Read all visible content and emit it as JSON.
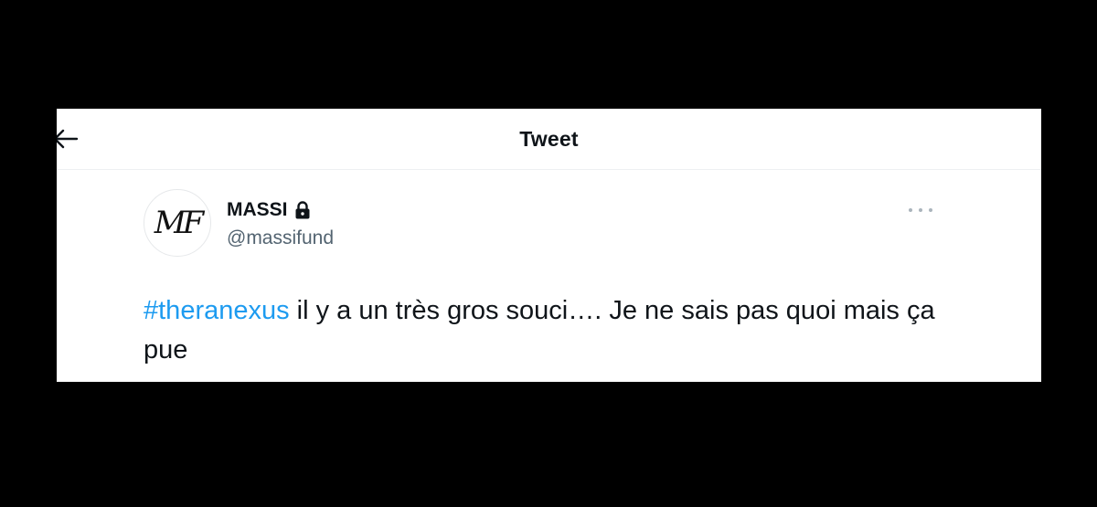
{
  "header": {
    "title": "Tweet",
    "back_icon": "arrow-left-icon"
  },
  "author": {
    "avatar_text": "MF",
    "display_name": "MASSI",
    "protected_icon": "lock-icon",
    "handle": "@massifund"
  },
  "more_icon": "more-dots-icon",
  "tweet": {
    "hashtag": "#theranexus",
    "text": " il y a un très gros souci…. Je ne sais pas quoi mais ça pue"
  },
  "colors": {
    "link": "#1d9bf0",
    "text": "#0f1419",
    "secondary": "#536471",
    "frame": "#000000"
  }
}
